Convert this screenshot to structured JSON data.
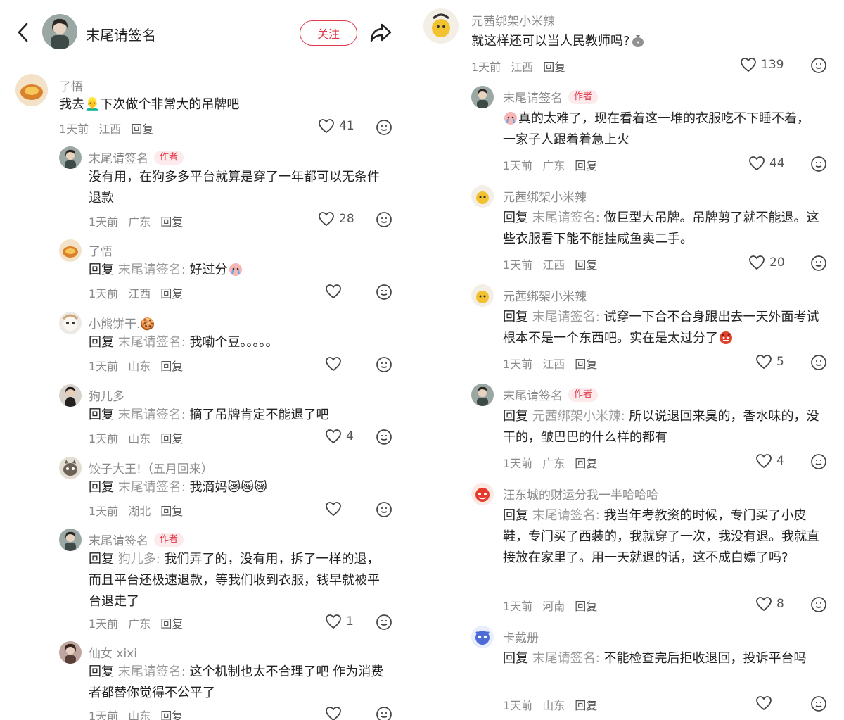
{
  "header": {
    "title": "末尾请签名",
    "follow_label": "关注"
  },
  "colors": {
    "accent": "#e0394a",
    "meta_gray": "#8a8a8a"
  },
  "left_comments": [
    {
      "name": "了悟",
      "text": "我去👱‍♂️下次做个非常大的吊牌吧",
      "time": "1天前",
      "location": "江西",
      "reply": "回复",
      "likes": "41"
    },
    {
      "name": "末尾请签名",
      "badge": "作者",
      "text": "没有用，在狗多多平台就算是穿了一年都可以无条件退款",
      "time": "1天前",
      "location": "广东",
      "reply": "回复",
      "likes": "28"
    },
    {
      "name": "了悟",
      "prefix": "回复 ",
      "rname": "末尾请签名:",
      "text": " 好过分",
      "time": "1天前",
      "location": "江西",
      "reply": "回复",
      "likes": ""
    },
    {
      "name": "小熊饼干.🍪",
      "prefix": "回复 ",
      "rname": "末尾请签名:",
      "text": " 我嘞个豆。。。。。",
      "time": "1天前",
      "location": "山东",
      "reply": "回复",
      "likes": ""
    },
    {
      "name": "狗儿多",
      "prefix": "回复 ",
      "rname": "末尾请签名:",
      "text": " 摘了吊牌肯定不能退了吧",
      "time": "1天前",
      "location": "山东",
      "reply": "回复",
      "likes": "4"
    },
    {
      "name": "饺子大王!（五月回来）",
      "prefix": "回复 ",
      "rname": "末尾请签名:",
      "text": " 我滴妈😿😿😿",
      "time": "1天前",
      "location": "湖北",
      "reply": "回复",
      "likes": ""
    },
    {
      "name": "末尾请签名",
      "badge": "作者",
      "prefix": "回复 ",
      "rname": "狗儿多:",
      "text": " 我们弄了的，没有用，拆了一样的退，而且平台还极速退款，等我们收到衣服，钱早就被平台退走了",
      "time": "1天前",
      "location": "广东",
      "reply": "回复",
      "likes": "1"
    },
    {
      "name": "仙女 xixi",
      "prefix": "回复 ",
      "rname": "末尾请签名:",
      "text": " 这个机制也太不合理了吧 作为消费者都替你觉得不公平了",
      "time": "1天前",
      "location": "山东",
      "reply": "回复",
      "likes": ""
    }
  ],
  "right_comments": [
    {
      "name": "元茜绑架小米辣",
      "text": "就这样还可以当人民教师吗?",
      "time": "1天前",
      "location": "江西",
      "reply": "回复",
      "likes": "139"
    },
    {
      "name": "末尾请签名",
      "badge": "作者",
      "text": "真的太难了，现在看着这一堆的衣服吃不下睡不着，一家子人跟着着急上火",
      "time": "1天前",
      "location": "广东",
      "reply": "回复",
      "likes": "44"
    },
    {
      "name": "元茜绑架小米辣",
      "prefix": "回复 ",
      "rname": "末尾请签名:",
      "text": " 做巨型大吊牌。吊牌剪了就不能退。这些衣服看下能不能挂咸鱼卖二手。",
      "time": "1天前",
      "location": "江西",
      "reply": "回复",
      "likes": "20"
    },
    {
      "name": "元茜绑架小米辣",
      "prefix": "回复 ",
      "rname": "末尾请签名:",
      "text": " 试穿一下合不合身跟出去一天外面考试根本不是一个东西吧。实在是太过分了",
      "time": "1天前",
      "location": "江西",
      "reply": "回复",
      "likes": "5"
    },
    {
      "name": "末尾请签名",
      "badge": "作者",
      "prefix": "回复 ",
      "rname": "元茜绑架小米辣:",
      "text": " 所以说退回来臭的，香水味的，没干的，皱巴巴的什么样的都有",
      "time": "1天前",
      "location": "广东",
      "reply": "回复",
      "likes": "4"
    },
    {
      "name": "汪东城的财运分我一半哈哈哈",
      "prefix": "回复 ",
      "rname": "末尾请签名:",
      "text": " 我当年考教资的时候，专门买了小皮鞋，专门买了西装的，我就穿了一次，我没有退。我就直接放在家里了。用一天就退的话，这不成白嫖了吗?",
      "time": "1天前",
      "location": "河南",
      "reply": "回复",
      "likes": "8"
    },
    {
      "name": "卡戴册",
      "prefix": "回复 ",
      "rname": "末尾请签名:",
      "text": " 不能检查完后拒收退回，投诉平台吗",
      "time": "1天前",
      "location": "山东",
      "reply": "回复",
      "likes": ""
    }
  ]
}
